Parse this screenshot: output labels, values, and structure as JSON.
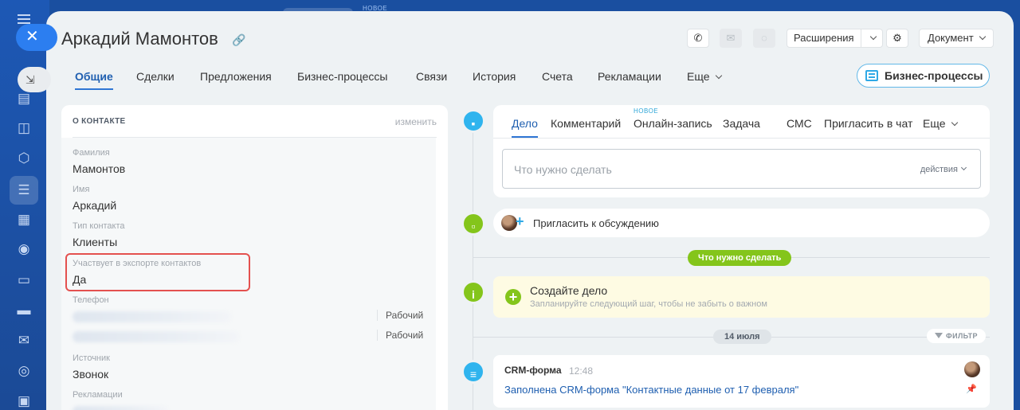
{
  "sidebar": {
    "close_glyph": "✕",
    "collapse_glyph": "⇲",
    "icons": [
      "tasks-icon",
      "chat-icon",
      "hexagon-icon",
      "crm-icon",
      "calendar-icon",
      "robot-icon",
      "document-icon",
      "card-icon",
      "mail-icon",
      "contacts-icon",
      "grid-icon"
    ]
  },
  "background_tab": {
    "badge": "НОВОЕ"
  },
  "header": {
    "title": "Аркадий Мамонтов",
    "extensions_label": "Расширения",
    "document_label": "Документ"
  },
  "tabs": [
    {
      "label": "Общие",
      "active": true
    },
    {
      "label": "Сделки"
    },
    {
      "label": "Предложения"
    },
    {
      "label": "Бизнес-процессы"
    },
    {
      "label": "Связи"
    },
    {
      "label": "История"
    },
    {
      "label": "Счета"
    },
    {
      "label": "Рекламации"
    },
    {
      "label": "Еще"
    }
  ],
  "bp_button": "Бизнес-процессы",
  "contact_card": {
    "heading": "О КОНТАКТЕ",
    "edit_label": "изменить",
    "fields": {
      "last_name": {
        "label": "Фамилия",
        "value": "Мамонтов"
      },
      "first_name": {
        "label": "Имя",
        "value": "Аркадий"
      },
      "type": {
        "label": "Тип контакта",
        "value": "Клиенты"
      },
      "export": {
        "label": "Участвует в экспорте контактов",
        "value": "Да"
      },
      "phone": {
        "label": "Телефон",
        "types": [
          "Рабочий",
          "Рабочий"
        ]
      },
      "source": {
        "label": "Источник",
        "value": "Звонок"
      },
      "claims": {
        "label": "Рекламации"
      }
    }
  },
  "activity": {
    "tabs": [
      "Дело",
      "Комментарий",
      "Онлайн-запись",
      "Задача",
      "СМС",
      "Пригласить в чат",
      "Еще"
    ],
    "new_badge": "НОВОЕ",
    "placeholder": "Что нужно сделать",
    "actions_label": "действия"
  },
  "invite": {
    "text": "Пригласить к обсуждению"
  },
  "todo_pill": "Что нужно сделать",
  "todo": {
    "title": "Создайте дело",
    "subtitle": "Запланируйте следующий шаг, чтобы не забыть о важном"
  },
  "date_pill": "14 июля",
  "filter_label": "ФИЛЬТР",
  "crm_item": {
    "title": "CRM-форма",
    "time": "12:48",
    "link": "Заполнена CRM-форма \"Контактные данные от 17 февраля\""
  },
  "colors": {
    "accent_blue": "#2f76d4",
    "green": "#84c51b",
    "highlight_red": "#e4514f",
    "timeline_blue": "#2fb4ee"
  }
}
